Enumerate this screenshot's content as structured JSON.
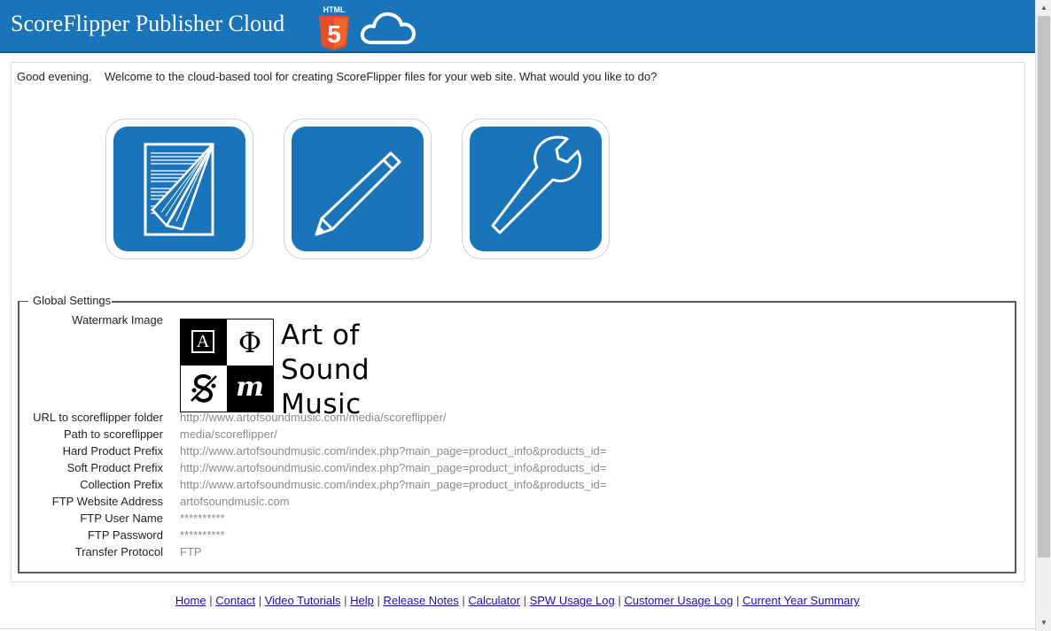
{
  "header": {
    "app_title": "ScoreFlipper Publisher Cloud",
    "html5_badge": "HTML",
    "html5_number": "5",
    "brand_color": "#1a74ba"
  },
  "main": {
    "greeting": "Good evening.    Welcome to the cloud-based tool for creating ScoreFlipper files for your web site. What would you like to do?",
    "tiles": [
      {
        "icon": "sheet-music-icon"
      },
      {
        "icon": "pencil-icon"
      },
      {
        "icon": "wrench-icon"
      }
    ]
  },
  "settings": {
    "legend": "Global Settings",
    "watermark": {
      "label": "Watermark Image",
      "logo_letters": [
        "A",
        "Φ",
        "𝄋",
        "m"
      ],
      "logo_text": [
        "Art of",
        "Sound",
        "Music"
      ]
    },
    "rows": [
      {
        "label": "URL to scoreflipper folder",
        "value": "http://www.artofsoundmusic.com/media/scoreflipper/"
      },
      {
        "label": "Path to scoreflipper",
        "value": "media/scoreflipper/"
      },
      {
        "label": "Hard Product Prefix",
        "value": "http://www.artofsoundmusic.com/index.php?main_page=product_info&products_id="
      },
      {
        "label": "Soft Product Prefix",
        "value": "http://www.artofsoundmusic.com/index.php?main_page=product_info&products_id="
      },
      {
        "label": "Collection Prefix",
        "value": "http://www.artofsoundmusic.com/index.php?main_page=product_info&products_id="
      },
      {
        "label": "FTP Website Address",
        "value": "artofsoundmusic.com"
      },
      {
        "label": "FTP User Name",
        "value": "**********"
      },
      {
        "label": "FTP Password",
        "value": "**********"
      },
      {
        "label": "Transfer Protocol",
        "value": "FTP"
      }
    ]
  },
  "footer": {
    "separator": "|",
    "links": [
      "Home",
      "Contact",
      "Video Tutorials",
      "Help",
      "Release Notes",
      "Calculator",
      "SPW Usage Log",
      "Customer Usage Log",
      "Current Year Summary"
    ]
  },
  "scrollbar": {
    "up_glyph": "▲",
    "down_glyph": "▼"
  }
}
